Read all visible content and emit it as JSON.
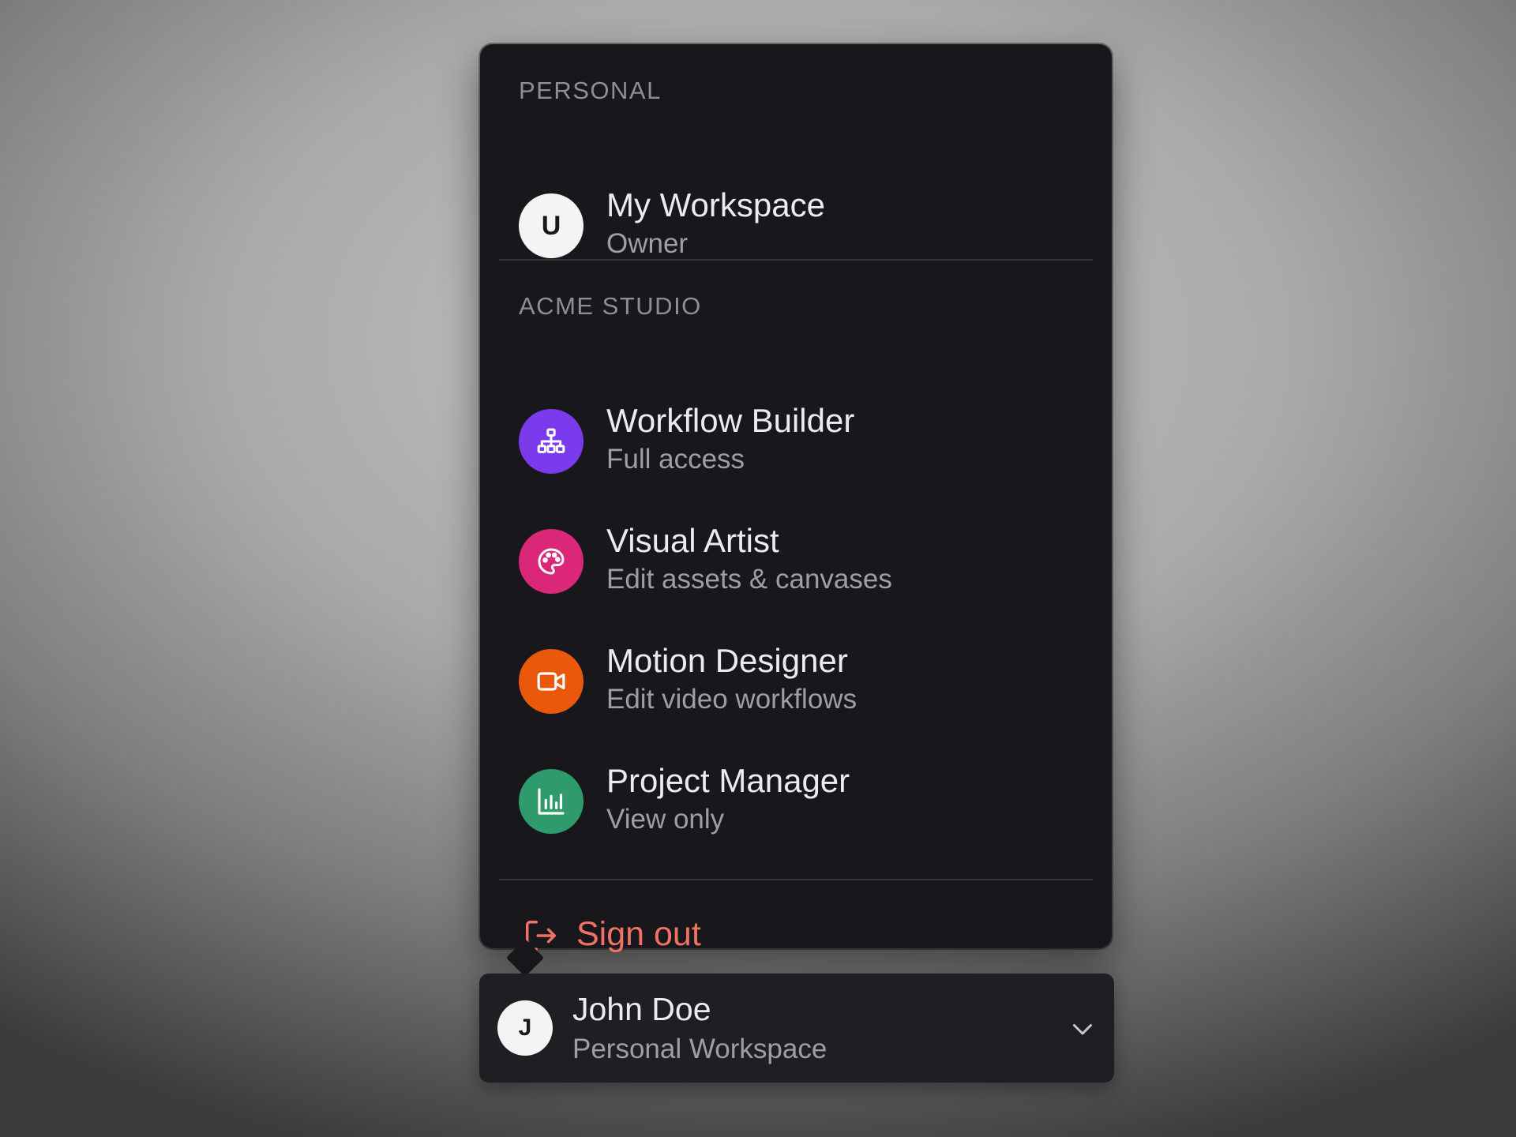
{
  "menu": {
    "personal_section": {
      "label": "PERSONAL",
      "items": [
        {
          "title": "My Workspace",
          "role": "Owner",
          "avatar_letter": "U",
          "icon": "letter-avatar",
          "color": "#f4f4f5"
        }
      ]
    },
    "org_section": {
      "label": "ACME STUDIO",
      "items": [
        {
          "title": "Workflow Builder",
          "role": "Full access",
          "icon": "sitemap-icon",
          "color": "#7c3aed"
        },
        {
          "title": "Visual Artist",
          "role": "Edit assets & canvases",
          "icon": "palette-icon",
          "color": "#db2777"
        },
        {
          "title": "Motion Designer",
          "role": "Edit video workflows",
          "icon": "video-icon",
          "color": "#ea580c"
        },
        {
          "title": "Project Manager",
          "role": "View only",
          "icon": "bar-chart-icon",
          "color": "#2f9a6b"
        }
      ]
    },
    "sign_out": {
      "label": "Sign out",
      "icon": "logout-icon",
      "color": "#f07265"
    }
  },
  "switcher": {
    "avatar_letter": "J",
    "name": "John Doe",
    "workspace": "Personal Workspace",
    "icon": "chevron-down-icon"
  }
}
